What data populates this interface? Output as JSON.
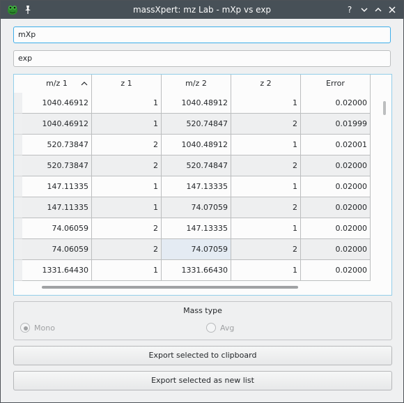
{
  "window": {
    "title": "massXpert: mz Lab - mXp vs exp"
  },
  "fields": {
    "first_value": "mXp",
    "second_value": "exp"
  },
  "table": {
    "columns": [
      "m/z 1",
      "z 1",
      "m/z 2",
      "z 2",
      "Error"
    ],
    "sort_indicator": "^",
    "rows": [
      [
        "1040.46912",
        "1",
        "1040.48912",
        "1",
        "0.02000"
      ],
      [
        "1040.46912",
        "1",
        "520.74847",
        "2",
        "0.01999"
      ],
      [
        "520.73847",
        "2",
        "1040.48912",
        "1",
        "0.02001"
      ],
      [
        "520.73847",
        "2",
        "520.74847",
        "2",
        "0.02000"
      ],
      [
        "147.11335",
        "1",
        "147.13335",
        "1",
        "0.02000"
      ],
      [
        "147.11335",
        "1",
        "74.07059",
        "2",
        "0.02000"
      ],
      [
        "74.06059",
        "2",
        "147.13335",
        "1",
        "0.02000"
      ],
      [
        "74.06059",
        "2",
        "74.07059",
        "2",
        "0.02000"
      ],
      [
        "1331.64430",
        "1",
        "1331.66430",
        "1",
        "0.02000"
      ]
    ]
  },
  "mass_type": {
    "title": "Mass type",
    "mono_label": "Mono",
    "avg_label": "Avg",
    "selected": "Mono"
  },
  "buttons": {
    "export_clipboard": "Export selected to clipboard",
    "export_new_list": "Export selected as new list"
  },
  "icons": {
    "app": "frog-icon",
    "pin": "pin-icon",
    "help": "?",
    "minimize": "v",
    "maximize": "^",
    "close": "x"
  }
}
